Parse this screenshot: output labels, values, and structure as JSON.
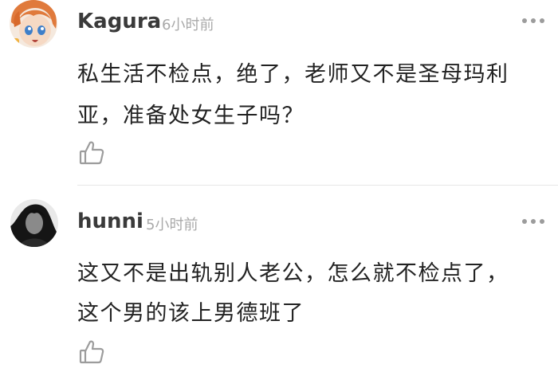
{
  "comments": [
    {
      "username": "Kagura",
      "time": "6小时前",
      "lines": [
        "私生活不检点，绝了，老师又不是圣母玛利",
        "亚，准备处女生子吗？"
      ],
      "avatar_icon": "anime-girl-avatar",
      "more_icon": "more-dots-icon",
      "like_icon": "thumbs-up-icon"
    },
    {
      "username": "hunni",
      "time": "5小时前",
      "lines": [
        "这又不是出轨别人老公，怎么就不检点了，",
        "这个男的该上男德班了"
      ],
      "avatar_icon": "photo-avatar",
      "more_icon": "more-dots-icon",
      "like_icon": "thumbs-up-icon"
    }
  ],
  "colors": {
    "username": "#3a3a3a",
    "timestamp": "#a9a9a9",
    "text": "#222222",
    "icon": "#9c9c9c",
    "divider": "#e6e6e6"
  }
}
